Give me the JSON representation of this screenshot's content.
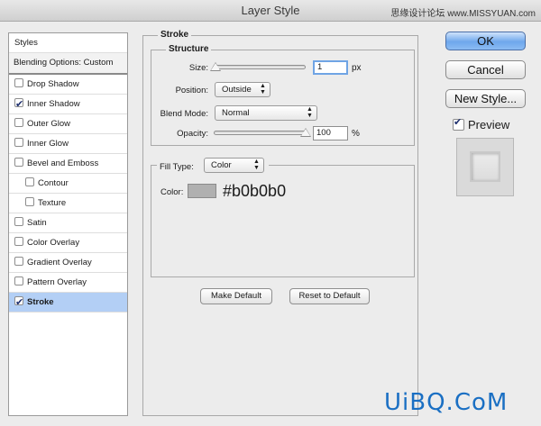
{
  "window": {
    "title": "Layer Style",
    "watermark_top": "思缘设计论坛 www.MISSYUAN.com",
    "watermark_bottom": "UiBQ.CoM"
  },
  "styles_list": {
    "title": "Styles",
    "blending": "Blending Options: Custom",
    "items": [
      {
        "label": "Drop Shadow",
        "checked": false,
        "indent": false,
        "selected": false
      },
      {
        "label": "Inner Shadow",
        "checked": true,
        "indent": false,
        "selected": false
      },
      {
        "label": "Outer Glow",
        "checked": false,
        "indent": false,
        "selected": false
      },
      {
        "label": "Inner Glow",
        "checked": false,
        "indent": false,
        "selected": false
      },
      {
        "label": "Bevel and Emboss",
        "checked": false,
        "indent": false,
        "selected": false
      },
      {
        "label": "Contour",
        "checked": false,
        "indent": true,
        "selected": false
      },
      {
        "label": "Texture",
        "checked": false,
        "indent": true,
        "selected": false
      },
      {
        "label": "Satin",
        "checked": false,
        "indent": false,
        "selected": false
      },
      {
        "label": "Color Overlay",
        "checked": false,
        "indent": false,
        "selected": false
      },
      {
        "label": "Gradient Overlay",
        "checked": false,
        "indent": false,
        "selected": false
      },
      {
        "label": "Pattern Overlay",
        "checked": false,
        "indent": false,
        "selected": false
      },
      {
        "label": "Stroke",
        "checked": true,
        "indent": false,
        "selected": true
      }
    ]
  },
  "stroke": {
    "title": "Stroke",
    "structure_title": "Structure",
    "size_label": "Size:",
    "size_value": "1",
    "size_unit": "px",
    "size_fraction": 0.0,
    "position_label": "Position:",
    "position_value": "Outside",
    "blend_label": "Blend Mode:",
    "blend_value": "Normal",
    "opacity_label": "Opacity:",
    "opacity_value": "100",
    "opacity_unit": "%",
    "opacity_fraction": 1.0,
    "fill_type_label": "Fill Type:",
    "fill_type_value": "Color",
    "color_label": "Color:",
    "color_hex_text": "#b0b0b0",
    "color_value": "#b0b0b0",
    "make_default": "Make Default",
    "reset_default": "Reset to Default"
  },
  "buttons": {
    "ok": "OK",
    "cancel": "Cancel",
    "new_style": "New Style...",
    "preview": "Preview",
    "preview_checked": true
  },
  "colors": {
    "accent": "#6ea7ec",
    "selection": "#b3cff5",
    "watermark": "#1a6fc3"
  }
}
